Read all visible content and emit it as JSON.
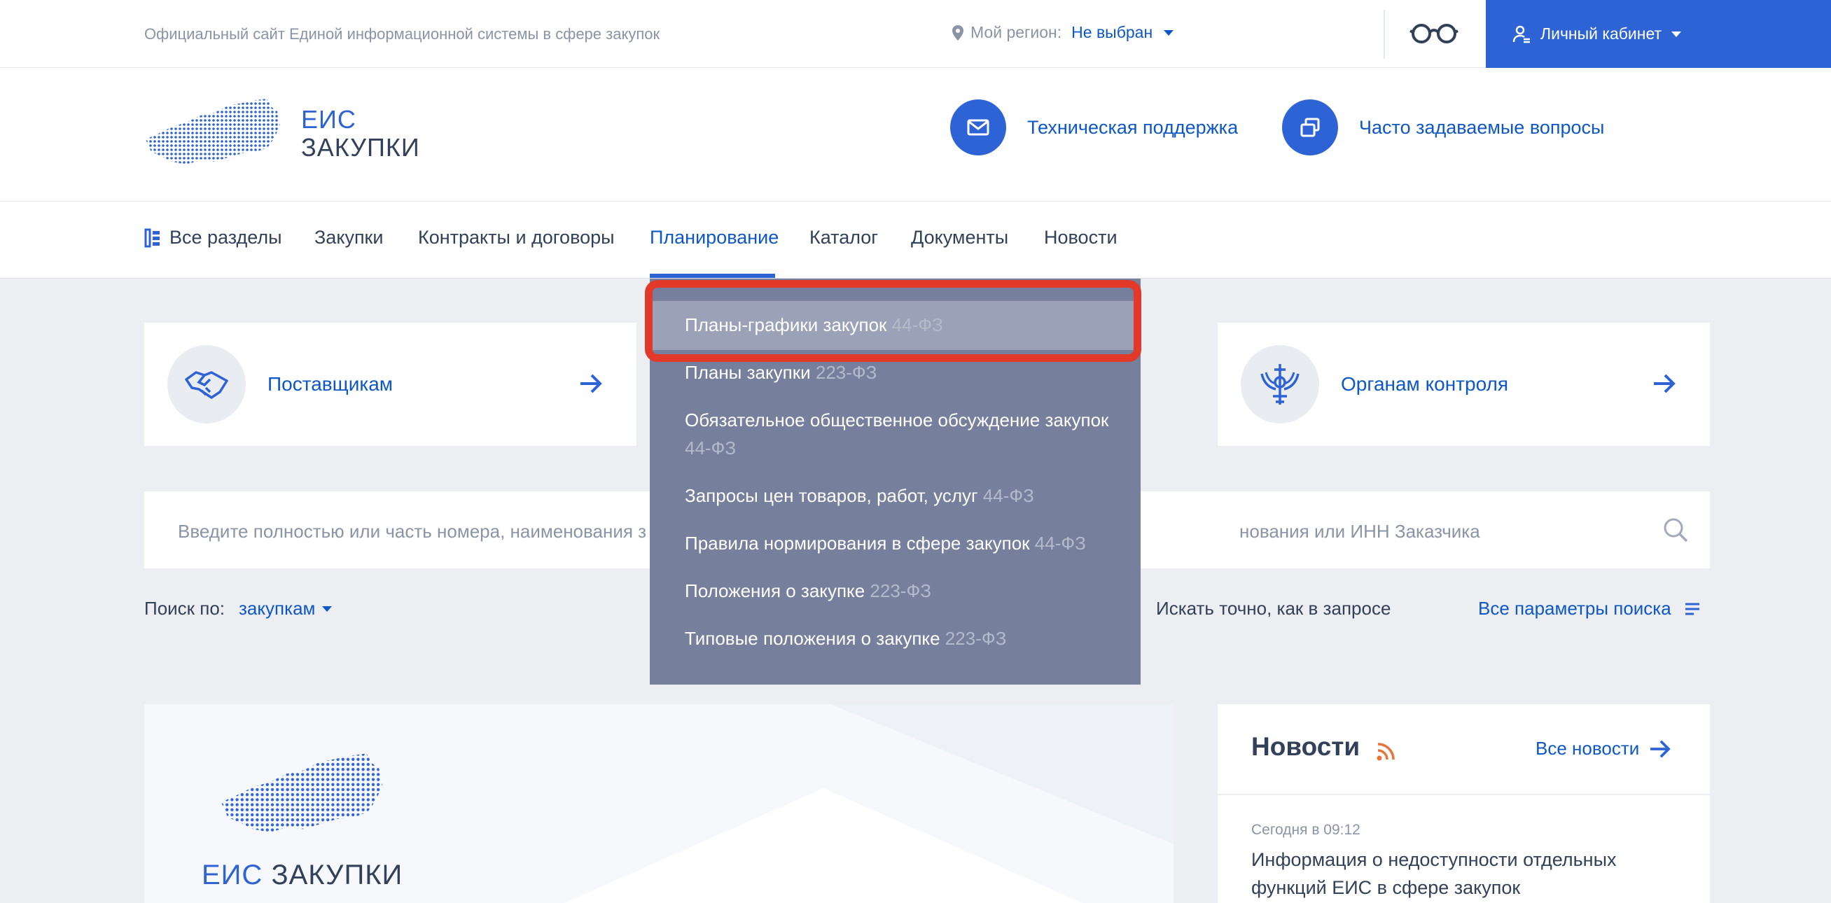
{
  "topbar": {
    "site_title": "Официальный сайт Единой информационной системы в сфере закупок",
    "region_label": "Мой регион:",
    "region_value": "Не выбран",
    "cabinet_label": "Личный кабинет"
  },
  "header": {
    "logo_line1": "ЕИС",
    "logo_line2": "ЗАКУПКИ",
    "support_label": "Техническая поддержка",
    "faq_label": "Часто задаваемые вопросы"
  },
  "nav": {
    "items": [
      {
        "label": "Все разделы"
      },
      {
        "label": "Закупки"
      },
      {
        "label": "Контракты и договоры"
      },
      {
        "label": "Планирование"
      },
      {
        "label": "Каталог"
      },
      {
        "label": "Документы"
      },
      {
        "label": "Новости"
      }
    ],
    "active": "Планирование"
  },
  "dropdown": {
    "items": [
      {
        "label": "Планы-графики закупок",
        "law": "44-ФЗ"
      },
      {
        "label": "Планы закупки",
        "law": "223-ФЗ"
      },
      {
        "label": "Обязательное общественное обсуждение закупок",
        "law": "44-ФЗ"
      },
      {
        "label": "Запросы цен товаров, работ, услуг",
        "law": "44-ФЗ"
      },
      {
        "label": "Правила нормирования в сфере закупок",
        "law": "44-ФЗ"
      },
      {
        "label": "Положения о закупке",
        "law": "223-ФЗ"
      },
      {
        "label": "Типовые положения о закупке",
        "law": "223-ФЗ"
      }
    ]
  },
  "cards": {
    "suppliers": "Поставщикам",
    "control": "Органам контроля"
  },
  "search": {
    "placeholder_left": "Введите полностью или часть номера, наименования з",
    "placeholder_right": "нования или ИНН Заказчика",
    "by_label": "Поиск по:",
    "by_value": "закупкам",
    "exact_label": "Искать точно, как в запросе",
    "all_params": "Все параметры поиска"
  },
  "banner": {
    "line_a": "ЕИС",
    "line_b": "ЗАКУПКИ"
  },
  "news": {
    "title": "Новости",
    "all_label": "Все новости",
    "date": "Сегодня в 09:12",
    "headline": "Информация о недоступности отдельных функций ЕИС в сфере закупок"
  },
  "colors": {
    "accent": "#2e63d6",
    "link": "#0d57c7",
    "dropdown_bg": "#767f9b",
    "highlight_frame": "#e2392b"
  }
}
